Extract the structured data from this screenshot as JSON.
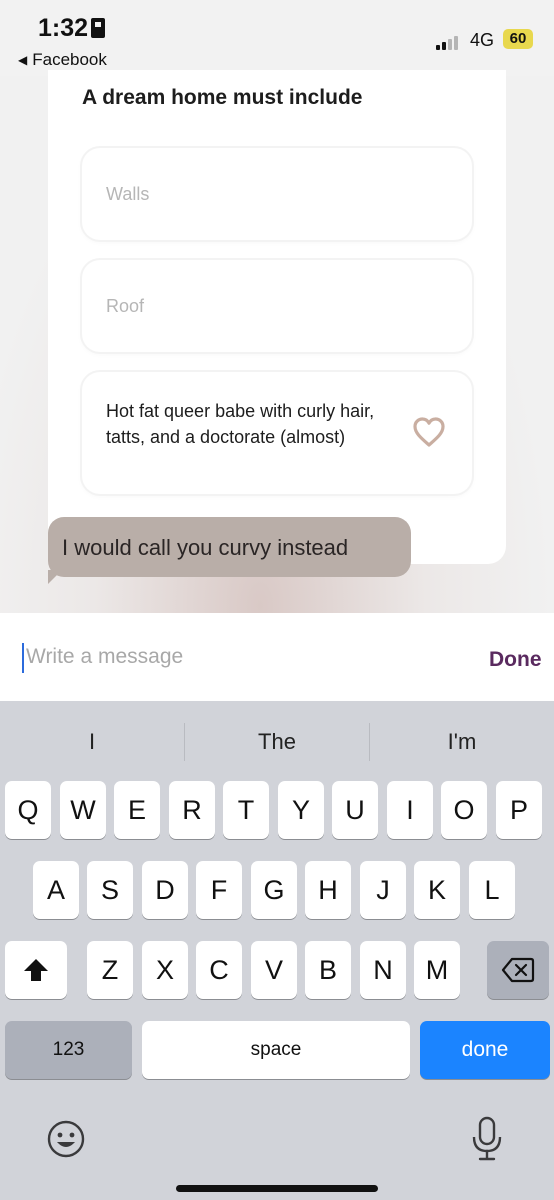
{
  "status_bar": {
    "time": "1:32",
    "back_app": "Facebook",
    "network": "4G",
    "battery": "60"
  },
  "card": {
    "title": "A dream home must include",
    "options": [
      {
        "text": "Walls",
        "selected": false
      },
      {
        "text": "Roof",
        "selected": false
      },
      {
        "text": "Hot fat queer babe with curly hair, tatts, and a doctorate (almost)",
        "selected": true
      }
    ]
  },
  "message": {
    "bubble_text": "I would call you curvy instead"
  },
  "compose": {
    "placeholder": "Write a message",
    "done_label": "Done"
  },
  "keyboard": {
    "suggestions": [
      "I",
      "The",
      "I'm"
    ],
    "row1": [
      "Q",
      "W",
      "E",
      "R",
      "T",
      "Y",
      "U",
      "I",
      "O",
      "P"
    ],
    "row2": [
      "A",
      "S",
      "D",
      "F",
      "G",
      "H",
      "J",
      "K",
      "L"
    ],
    "row3": [
      "Z",
      "X",
      "C",
      "V",
      "B",
      "N",
      "M"
    ],
    "numbers_key": "123",
    "space_key": "space",
    "return_key": "done",
    "icons": {
      "shift": "shift-icon",
      "delete": "backspace-icon",
      "emoji": "emoji-icon",
      "mic": "microphone-icon"
    }
  },
  "colors": {
    "done_accent": "#5a2a5f",
    "bubble": "#b9aea8",
    "return_key": "#1b84ff"
  }
}
